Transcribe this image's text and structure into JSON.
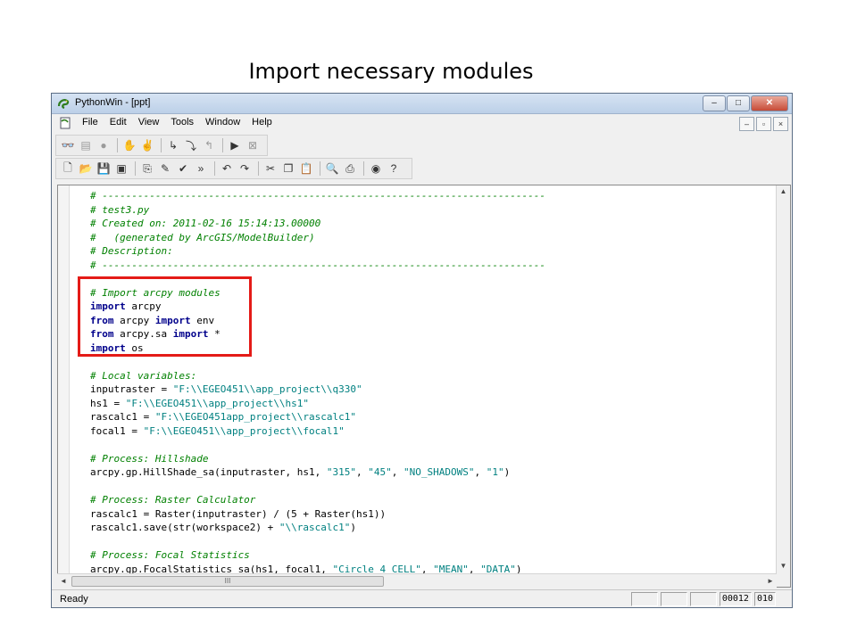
{
  "slide": {
    "title": "Import necessary modules"
  },
  "window": {
    "title": "PythonWin - [ppt]",
    "controls": {
      "minimize": "–",
      "maximize": "□",
      "close": "✕"
    }
  },
  "menubar": {
    "items": [
      "File",
      "Edit",
      "View",
      "Tools",
      "Window",
      "Help"
    ],
    "mdi": {
      "minimize": "–",
      "restore": "▫",
      "close": "×"
    }
  },
  "icons": {
    "app": "python-snake-icon",
    "toolbar1": [
      "glasses-icon",
      "watch-icon",
      "stop-icon",
      "hand-icon",
      "hand-debug-icon",
      "step-in-icon",
      "step-over-icon",
      "step-out-icon",
      "run-icon",
      "close-debug-icon"
    ],
    "toolbar2": [
      "new-file-icon",
      "open-icon",
      "save-icon",
      "save-all-icon",
      "paste-special-icon",
      "pen-icon",
      "check-icon",
      "indent-icon",
      "undo-icon",
      "redo-icon",
      "cut-icon",
      "copy-icon",
      "paste-icon",
      "print-preview-icon",
      "print-icon",
      "help-icon",
      "about-icon"
    ]
  },
  "code_lines": [
    [
      {
        "t": "# ---------------------------------------------------------------------------",
        "c": "comment"
      }
    ],
    [
      {
        "t": "# test3.py",
        "c": "comment"
      }
    ],
    [
      {
        "t": "# Created on: 2011-02-16 15:14:13.00000",
        "c": "comment"
      }
    ],
    [
      {
        "t": "#   (generated by ArcGIS/ModelBuilder)",
        "c": "comment"
      }
    ],
    [
      {
        "t": "# Description:",
        "c": "comment"
      }
    ],
    [
      {
        "t": "# ---------------------------------------------------------------------------",
        "c": "comment"
      }
    ],
    [],
    [
      {
        "t": "# Import arcpy modules",
        "c": "comment"
      }
    ],
    [
      {
        "t": "import",
        "c": "kw"
      },
      {
        "t": " arcpy",
        "c": ""
      }
    ],
    [
      {
        "t": "from",
        "c": "kw"
      },
      {
        "t": " arcpy ",
        "c": ""
      },
      {
        "t": "import",
        "c": "kw"
      },
      {
        "t": " env",
        "c": ""
      }
    ],
    [
      {
        "t": "from",
        "c": "kw"
      },
      {
        "t": " arcpy.sa ",
        "c": ""
      },
      {
        "t": "import",
        "c": "kw"
      },
      {
        "t": " *",
        "c": ""
      }
    ],
    [
      {
        "t": "import",
        "c": "kw"
      },
      {
        "t": " os",
        "c": ""
      }
    ],
    [],
    [
      {
        "t": "# Local variables:",
        "c": "comment"
      }
    ],
    [
      {
        "t": "inputraster = ",
        "c": ""
      },
      {
        "t": "\"F:\\\\EGEO451\\\\app_project\\\\q330\"",
        "c": "str"
      }
    ],
    [
      {
        "t": "hs1 = ",
        "c": ""
      },
      {
        "t": "\"F:\\\\EGEO451\\\\app_project\\\\hs1\"",
        "c": "str"
      }
    ],
    [
      {
        "t": "rascalc1 = ",
        "c": ""
      },
      {
        "t": "\"F:\\\\EGEO451app_project\\\\rascalc1\"",
        "c": "str"
      }
    ],
    [
      {
        "t": "focal1 = ",
        "c": ""
      },
      {
        "t": "\"F:\\\\EGEO451\\\\app_project\\\\focal1\"",
        "c": "str"
      }
    ],
    [],
    [
      {
        "t": "# Process: Hillshade",
        "c": "comment"
      }
    ],
    [
      {
        "t": "arcpy.gp.HillShade_sa(inputraster, hs1, ",
        "c": ""
      },
      {
        "t": "\"315\"",
        "c": "str"
      },
      {
        "t": ", ",
        "c": ""
      },
      {
        "t": "\"45\"",
        "c": "str"
      },
      {
        "t": ", ",
        "c": ""
      },
      {
        "t": "\"NO_SHADOWS\"",
        "c": "str"
      },
      {
        "t": ", ",
        "c": ""
      },
      {
        "t": "\"1\"",
        "c": "str"
      },
      {
        "t": ")",
        "c": ""
      }
    ],
    [],
    [
      {
        "t": "# Process: Raster Calculator",
        "c": "comment"
      }
    ],
    [
      {
        "t": "rascalc1 = Raster(inputraster) / (5 + Raster(hs1))",
        "c": ""
      }
    ],
    [
      {
        "t": "rascalc1.save(str(workspace2) + ",
        "c": ""
      },
      {
        "t": "\"\\\\rascalc1\"",
        "c": "str"
      },
      {
        "t": ")",
        "c": ""
      }
    ],
    [],
    [
      {
        "t": "# Process: Focal Statistics",
        "c": "comment"
      }
    ],
    [
      {
        "t": "arcpy.gp.FocalStatistics_sa(hs1, focal1, ",
        "c": ""
      },
      {
        "t": "\"Circle 4 CELL\"",
        "c": "str"
      },
      {
        "t": ", ",
        "c": ""
      },
      {
        "t": "\"MEAN\"",
        "c": "str"
      },
      {
        "t": ", ",
        "c": ""
      },
      {
        "t": "\"DATA\"",
        "c": "str"
      },
      {
        "t": ")",
        "c": ""
      }
    ]
  ],
  "scrollbars": {
    "up": "▲",
    "down": "▼",
    "left": "◄",
    "right": "►",
    "grip": "III"
  },
  "statusbar": {
    "text": "Ready",
    "line": "00012",
    "col": "010"
  },
  "colors": {
    "highlight": "#e41b17",
    "comment": "#008000",
    "keyword": "#00008b",
    "string": "#008080"
  }
}
